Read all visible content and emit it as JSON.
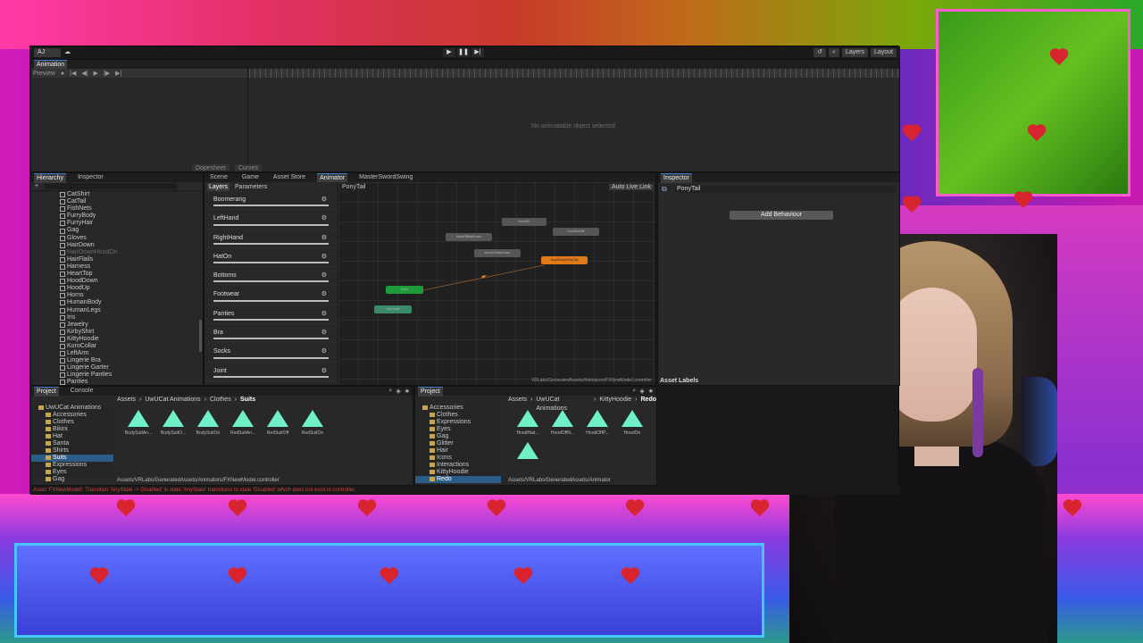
{
  "toolbar": {
    "account": "AJ",
    "play": "▶",
    "pause": "❚❚",
    "step": "▶|",
    "history": "↺",
    "search": "⌕",
    "layers": "Layers",
    "layout": "Layout"
  },
  "animation": {
    "tab": "Animation",
    "preview": "Preview",
    "no_object": "No animatable object selected",
    "dopesheet": "Dopesheet",
    "curves": "Curves"
  },
  "hierarchy": {
    "tabs": [
      "Hierarchy",
      "Inspector"
    ],
    "search_placeholder": "All",
    "items": [
      {
        "label": "CatShirt",
        "dim": false
      },
      {
        "label": "CatTail",
        "dim": false
      },
      {
        "label": "FishNets",
        "dim": false
      },
      {
        "label": "FurryBody",
        "dim": false
      },
      {
        "label": "FurryHair",
        "dim": false
      },
      {
        "label": "Gag",
        "dim": false
      },
      {
        "label": "Gloves",
        "dim": false
      },
      {
        "label": "HairDown",
        "dim": false
      },
      {
        "label": "HairDownHoodOn",
        "dim": true
      },
      {
        "label": "HairFlails",
        "dim": false
      },
      {
        "label": "Harness",
        "dim": false
      },
      {
        "label": "HeartTop",
        "dim": false
      },
      {
        "label": "HoodDown",
        "dim": false
      },
      {
        "label": "HoodUp",
        "dim": false
      },
      {
        "label": "Horns",
        "dim": false
      },
      {
        "label": "HumanBody",
        "dim": false
      },
      {
        "label": "HumanLegs",
        "dim": false
      },
      {
        "label": "Iris",
        "dim": false
      },
      {
        "label": "Jewelry",
        "dim": false
      },
      {
        "label": "KirbyShirt",
        "dim": false
      },
      {
        "label": "KittyHoodie",
        "dim": false
      },
      {
        "label": "KuroCollar",
        "dim": false
      },
      {
        "label": "LeftArm",
        "dim": false
      },
      {
        "label": "Lingerie Bra",
        "dim": false
      },
      {
        "label": "Lingerie Garter",
        "dim": false
      },
      {
        "label": "Lingerie Panties",
        "dim": false
      },
      {
        "label": "Panties",
        "dim": false
      }
    ]
  },
  "animator": {
    "tabs": [
      "Scene",
      "Game",
      "Asset Store",
      "Animator",
      "MasterSwordSwing"
    ],
    "active_tab": "Animator",
    "layer_tabs": [
      "Layers",
      "Parameters"
    ],
    "breadcrumb": "PonyTail",
    "auto_live_link": "Auto Live Link",
    "layers": [
      "Boomerang",
      "LeftHand",
      "RightHand",
      "HatOn",
      "Bottoms",
      "Footwear",
      "Panties",
      "Bra",
      "Socks",
      "Joint"
    ],
    "states": [
      {
        "label": "HoodOn",
        "kind": "normal"
      },
      {
        "label": "HoodOffHairDown",
        "kind": "normal"
      },
      {
        "label": "HoodOnHairDown",
        "kind": "normal"
      },
      {
        "label": "HoodOnHair",
        "kind": "normal"
      },
      {
        "label": "HoodDownPonyTail",
        "kind": "default"
      },
      {
        "label": "Entry",
        "kind": "entry"
      },
      {
        "label": "Any State",
        "kind": "any"
      }
    ],
    "path": "VRLabs/GeneratedAssets/Animators/FXNewModel.controller"
  },
  "inspector": {
    "tab": "Inspector",
    "name": "PonyTail",
    "add_behaviour": "Add Behaviour",
    "asset_labels": "Asset Labels"
  },
  "project1": {
    "tabs": [
      "Project",
      "Console"
    ],
    "tree": [
      {
        "label": "UwUCat Animations",
        "sel": false
      },
      {
        "label": "Accessories",
        "sel": false
      },
      {
        "label": "Clothes",
        "sel": false
      },
      {
        "label": "Bikini",
        "sel": false
      },
      {
        "label": "Hat",
        "sel": false
      },
      {
        "label": "Santa",
        "sel": false
      },
      {
        "label": "Shirts",
        "sel": false
      },
      {
        "label": "Suits",
        "sel": true
      },
      {
        "label": "Expressions",
        "sel": false
      },
      {
        "label": "Eyes",
        "sel": false
      },
      {
        "label": "Gag",
        "sel": false
      }
    ],
    "crumbs": [
      "Assets",
      "UwUCat Animations",
      "Clothes",
      "Suits"
    ],
    "assets": [
      "BodySuitAn...",
      "BodySuitO...",
      "BodySuitOn",
      "RedSuitAn...",
      "RedSuitOff",
      "RedSuitOn"
    ],
    "footer": "Assets/VRLabs/GeneratedAssets/Animators/FXNewModel.controller"
  },
  "project2": {
    "tabs": [
      "Project"
    ],
    "tree": [
      {
        "label": "Accessories",
        "sel": false
      },
      {
        "label": "Clothes",
        "sel": false
      },
      {
        "label": "Expressions",
        "sel": false
      },
      {
        "label": "Eyes",
        "sel": false
      },
      {
        "label": "Gag",
        "sel": false
      },
      {
        "label": "Glitter",
        "sel": false
      },
      {
        "label": "Hair",
        "sel": false
      },
      {
        "label": "Icons",
        "sel": false
      },
      {
        "label": "Interactions",
        "sel": false
      },
      {
        "label": "KittyHoodie",
        "sel": false
      },
      {
        "label": "Redo",
        "sel": true
      }
    ],
    "crumbs": [
      "Assets",
      "UwUCat Animations",
      "KittyHoodie",
      "Redo"
    ],
    "assets": [
      "HoodHair...",
      "HoodOffN...",
      "HoodOffP...",
      "HoodOn",
      ""
    ],
    "footer": "Assets/VRLabs/GeneratedAssets/Animator"
  },
  "status": {
    "error": "Asset 'FXNewModel': Transition 'AnyState -> Disabled' in state 'AnyState' transitions to state 'Disabled' which does not exist in controller."
  },
  "colors": {
    "state_default": "#e07a18",
    "state_entry": "#1e9a3a",
    "asset_icon": "#6ff0c8",
    "error_text": "#d04040"
  }
}
